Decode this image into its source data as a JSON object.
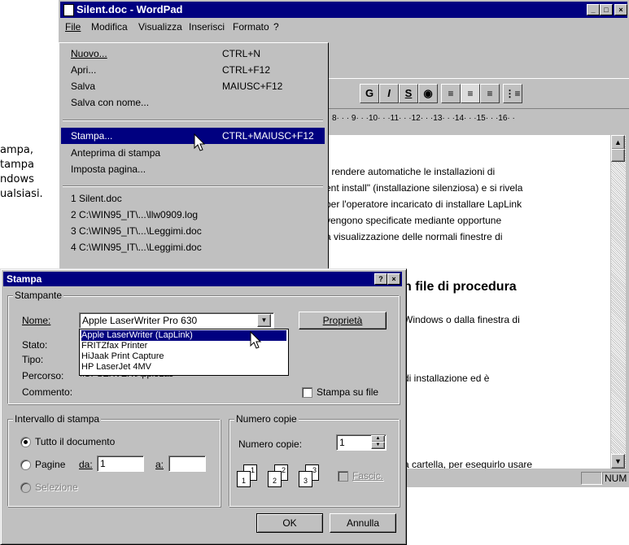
{
  "side_text": [
    "ampa,",
    "tampa",
    "ndows",
    "ualsiasi."
  ],
  "window": {
    "title": "Silent.doc - WordPad",
    "controls": [
      "_",
      "□",
      "×"
    ]
  },
  "menubar": [
    {
      "label": "File"
    },
    {
      "label": "Modifica"
    },
    {
      "label": "Visualizza"
    },
    {
      "label": "Inserisci"
    },
    {
      "label": "Formato"
    },
    {
      "label": "?"
    }
  ],
  "toolbar": {
    "bold": "G",
    "italic": "I",
    "underline": "S",
    "color": "",
    "align_left": "",
    "align_center": "",
    "align_right": "",
    "bullets": ""
  },
  "ruler": "8· · · 9· · ·10· · ·11· · ·12· · ·13· · ·14· · ·15· · ·16· ·",
  "file_menu": {
    "items": [
      {
        "label": "Nuovo...",
        "shortcut": "CTRL+N"
      },
      {
        "label": "Apri...",
        "shortcut": "CTRL+F12"
      },
      {
        "label": "Salva",
        "shortcut": "MAIUSC+F12"
      },
      {
        "label": "Salva con nome...",
        "shortcut": ""
      },
      {
        "label": "Stampa...",
        "shortcut": "CTRL+MAIUSC+F12"
      },
      {
        "label": "Anteprima di stampa",
        "shortcut": ""
      },
      {
        "label": "Imposta pagina...",
        "shortcut": ""
      },
      {
        "label": "1 Silent.doc",
        "shortcut": ""
      },
      {
        "label": "2 C:\\WIN95_IT\\...\\llw0909.log",
        "shortcut": ""
      },
      {
        "label": "3 C:\\WIN95_IT\\...\\Leggimi.doc",
        "shortcut": ""
      },
      {
        "label": "4 C:\\WIN95_IT\\...\\Leggimi.doc",
        "shortcut": ""
      }
    ]
  },
  "document": {
    "lines": [
      "r rendere automatiche le installazioni di",
      "ent install\" (installazione silenziosa) e si rivela",
      "per l'operatore incaricato di installare LapLink",
      "vengono specificate mediante opportune",
      "a visualizzazione delle normali finestre di"
    ],
    "heading": "n file di procedura",
    "lines2": [
      "Windows o dalla finestra di",
      "di installazione ed è",
      "a cartella, per eseguirlo usare"
    ]
  },
  "statusbar": {
    "num": "NUM"
  },
  "dialog": {
    "title": "Stampa",
    "title_buttons": [
      "?",
      "×"
    ],
    "printer_group": "Stampante",
    "name_label": "Nome:",
    "name_value": "Apple LaserWriter Pro 630",
    "properties_button": "Proprietà",
    "status_label": "Stato:",
    "type_label": "Tipo:",
    "path_label": "Percorso:",
    "path_value": "\\\\OPSERVER\\AppleLas",
    "comment_label": "Commento:",
    "print_to_file": "Stampa su file",
    "dropdown_options": [
      "Apple LaserWriter (LapLink)",
      "FRITZfax Printer",
      "HiJaak Print Capture",
      "HP LaserJet 4MV"
    ],
    "range_group": "Intervallo di stampa",
    "range_all": "Tutto il documento",
    "range_pages": "Pagine",
    "from_label": "da:",
    "from_value": "1",
    "to_label": "a:",
    "to_value": "",
    "range_selection": "Selezione",
    "copies_group": "Numero copie",
    "copies_label": "Numero copie:",
    "copies_value": "1",
    "collate": "Fascic.",
    "page_icons": [
      "1",
      "1",
      "2",
      "2",
      "3",
      "3"
    ],
    "ok": "OK",
    "cancel": "Annulla"
  }
}
